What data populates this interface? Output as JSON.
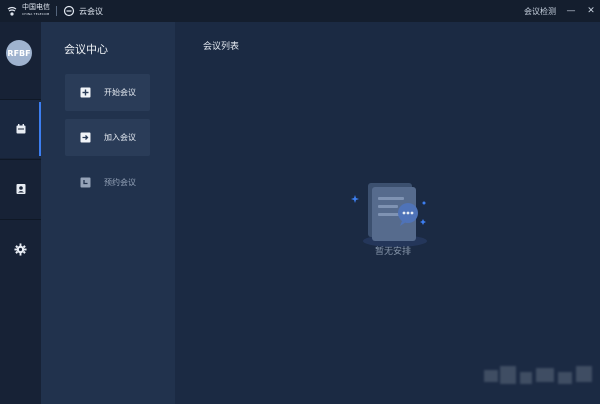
{
  "titlebar": {
    "brand_company": "中国电信",
    "brand_company_sub": "CHINA TELECOM",
    "brand_product": "云会议",
    "check_label": "会议检测",
    "minimize": "—",
    "close": "✕"
  },
  "rail": {
    "avatar_text": "RFBF",
    "items": [
      {
        "icon": "calendar-icon",
        "active": true
      },
      {
        "icon": "contacts-icon",
        "active": false
      },
      {
        "icon": "gear-icon",
        "active": false
      }
    ]
  },
  "panel": {
    "title": "会议中心",
    "items": [
      {
        "label": "开始会议",
        "icon": "plus-icon"
      },
      {
        "label": "加入会议",
        "icon": "join-icon"
      },
      {
        "label": "预约会议",
        "icon": "schedule-icon"
      }
    ]
  },
  "main": {
    "title": "会议列表",
    "empty_text": "暂无安排"
  },
  "colors": {
    "accent": "#3c7ef0",
    "background": "#1b2a43",
    "panel": "#21324d",
    "rail": "#172236"
  }
}
